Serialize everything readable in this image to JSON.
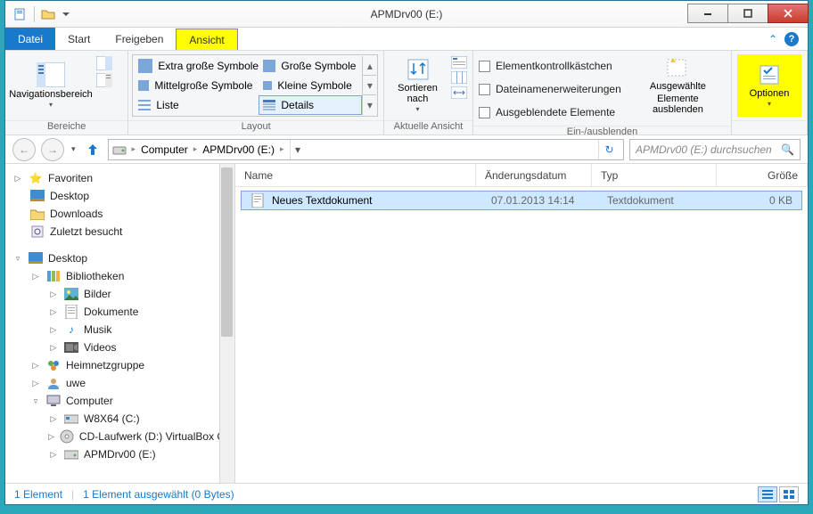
{
  "window": {
    "title": "APMDrv00 (E:)"
  },
  "tabs": {
    "file": "Datei",
    "start": "Start",
    "share": "Freigeben",
    "view": "Ansicht"
  },
  "ribbon": {
    "panes_label": "Bereiche",
    "nav_pane": "Navigationsbereich",
    "layout_label": "Layout",
    "layout": {
      "xl": "Extra große Symbole",
      "large": "Große Symbole",
      "medium": "Mittelgroße Symbole",
      "small": "Kleine Symbole",
      "list": "Liste",
      "details": "Details"
    },
    "current_view_label": "Aktuelle Ansicht",
    "sort_by": "Sortieren nach",
    "showhide_label": "Ein-/ausblenden",
    "chk_boxes": "Elementkontrollkästchen",
    "chk_ext": "Dateinamenerweiterungen",
    "chk_hidden": "Ausgeblendete Elemente",
    "hide_selected_1": "Ausgewählte",
    "hide_selected_2": "Elemente ausblenden",
    "options": "Optionen"
  },
  "breadcrumb": {
    "c1": "Computer",
    "c2": "APMDrv00 (E:)"
  },
  "search": {
    "placeholder": "APMDrv00 (E:) durchsuchen"
  },
  "tree": {
    "favorites": "Favoriten",
    "desktop1": "Desktop",
    "downloads": "Downloads",
    "recent": "Zuletzt besucht",
    "desktop2": "Desktop",
    "libraries": "Bibliotheken",
    "pictures": "Bilder",
    "documents": "Dokumente",
    "music": "Musik",
    "videos": "Videos",
    "homegroup": "Heimnetzgruppe",
    "user": "uwe",
    "computer": "Computer",
    "drive_c": "W8X64 (C:)",
    "drive_d": "CD-Laufwerk (D:) VirtualBox Guest A",
    "drive_e": "APMDrv00 (E:)"
  },
  "columns": {
    "name": "Name",
    "date": "Änderungsdatum",
    "type": "Typ",
    "size": "Größe"
  },
  "file": {
    "name": "Neues Textdokument",
    "date": "07.01.2013 14:14",
    "type": "Textdokument",
    "size": "0 KB"
  },
  "status": {
    "count": "1 Element",
    "selection": "1 Element ausgewählt (0 Bytes)"
  }
}
